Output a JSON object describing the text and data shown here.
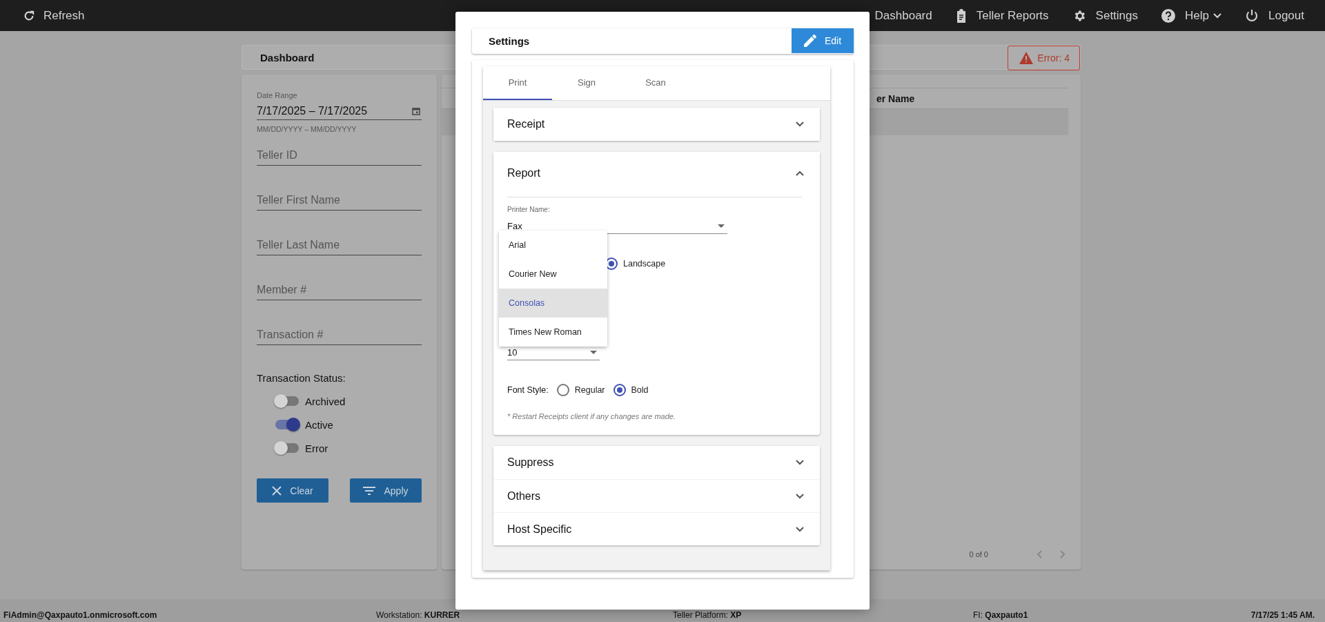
{
  "top_bar": {
    "refresh": "Refresh",
    "nav": [
      {
        "label": "Dashboard"
      },
      {
        "label": "Teller Reports",
        "kind": "clipboard"
      },
      {
        "label": "Settings",
        "kind": "gear"
      },
      {
        "label": "Help",
        "kind": "help",
        "dropdown": true
      },
      {
        "label": "Logout",
        "kind": "power"
      }
    ]
  },
  "page_header": {
    "title": "Dashboard",
    "error_badge": "Error: 4"
  },
  "filters": {
    "date_range": {
      "label": "Date Range",
      "value": "7/17/2025 – 7/17/2025",
      "hint": "MM/DD/YYYY – MM/DD/YYYY"
    },
    "fields": [
      {
        "placeholder": "Teller ID"
      },
      {
        "placeholder": "Teller First Name"
      },
      {
        "placeholder": "Teller Last Name"
      },
      {
        "placeholder": "Member #"
      },
      {
        "placeholder": "Transaction #"
      }
    ],
    "status_label": "Transaction Status:",
    "toggles": [
      {
        "label": "Archived",
        "on": false
      },
      {
        "label": "Active",
        "on": true
      },
      {
        "label": "Error",
        "on": false
      }
    ],
    "buttons": [
      {
        "label": "Clear",
        "kind": "close"
      },
      {
        "label": "Apply",
        "kind": "filter"
      }
    ]
  },
  "results": {
    "column_header": "er Name",
    "pager": "0 of 0"
  },
  "settings_dialog": {
    "title": "Settings",
    "edit_button": "Edit",
    "tabs": [
      {
        "label": "Print",
        "selected": true
      },
      {
        "label": "Sign",
        "selected": false
      },
      {
        "label": "Scan",
        "selected": false
      }
    ],
    "panels": [
      {
        "title": "Receipt",
        "expanded": false
      },
      {
        "title": "Report",
        "expanded": true
      },
      {
        "title": "Suppress",
        "expanded": false
      },
      {
        "title": "Others",
        "expanded": false
      },
      {
        "title": "Host Specific",
        "expanded": false
      }
    ],
    "report": {
      "printer_label": "Printer Name:",
      "printer_value": "Fax",
      "orientation_option": {
        "label": "Landscape",
        "selected": true
      },
      "font_size": "10",
      "font_style_label": "Font Style:",
      "font_styles": [
        {
          "label": "Regular",
          "selected": false
        },
        {
          "label": "Bold",
          "selected": true
        }
      ],
      "note": "* Restart Receipts client if any changes are made."
    },
    "font_menu": [
      {
        "label": "Arial",
        "selected": false
      },
      {
        "label": "Courier New",
        "selected": false
      },
      {
        "label": "Consolas",
        "selected": true
      },
      {
        "label": "Times New Roman",
        "selected": false
      }
    ]
  },
  "status_bar": {
    "user": "FiAdmin@Qaxpauto1.onmicrosoft.com",
    "items": [
      "Workstation: **KURRER**",
      "Teller Platform: **XP**",
      "FI: **Qaxpauto1**"
    ],
    "time": "7/17/25 1:45 AM."
  }
}
